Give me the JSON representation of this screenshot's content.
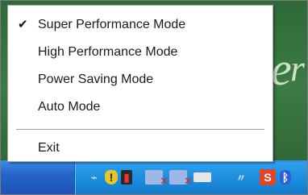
{
  "menu": {
    "items": [
      {
        "label": "Super Performance Mode",
        "checked": true
      },
      {
        "label": "High Performance Mode",
        "checked": false
      },
      {
        "label": "Power Saving Mode",
        "checked": false
      },
      {
        "label": "Auto Mode",
        "checked": false
      }
    ],
    "exit_label": "Exit",
    "check_glyph": "✔"
  },
  "taskbar": {
    "tray_icons": [
      "usb-icon",
      "shield-warning-icon",
      "speaker-icon",
      "network-disconnected-icon",
      "network-disconnected-icon",
      "display-icon",
      "app-s-icon",
      "bluetooth-icon"
    ],
    "shield_glyph": "!",
    "s_glyph": "S",
    "bt_glyph": "ᛒ"
  },
  "wallpaper": {
    "glyph_1": "e",
    "glyph_2": "r"
  },
  "colors": {
    "taskbar": "#245ed0",
    "tray": "#1c8ddd",
    "wallpaper": "#2e6a38"
  }
}
